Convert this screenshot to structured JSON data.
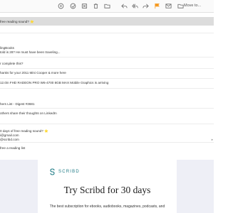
{
  "toolbar": {
    "move_label": "Move to...",
    "icons": [
      "archive-icon",
      "mark-unread-icon",
      "junk-icon",
      "trash-icon",
      "folder-icon",
      "reply-icon",
      "reply-all-icon",
      "forward-icon",
      "flag-icon",
      "email-icon"
    ],
    "flag_color": "#f59a23"
  },
  "message_list": {
    "rows": [
      {
        "text": "free reading sound? ⭐",
        "selected": true
      },
      {
        "text": "lingBooks",
        "selected": false
      },
      {
        "text": "told is 28? He must have been traveling...",
        "selected": false
      },
      {
        "text": "r complete this?",
        "selected": false
      },
      {
        "text": "hanks for your 2011 Mini Cooper & more here",
        "selected": false
      },
      {
        "text": "12.0in FHD RADEON PRO W6-4700 8GB MAX Mobile Graphics is arriving",
        "selected": false
      },
      {
        "text": "hers List - Digest #3681",
        "selected": false
      },
      {
        "text": "others share their thoughts on LinkedIn",
        "selected": false
      },
      {
        "text": "0 days of free reading sound? ⭐",
        "selected": false
      },
      {
        "text": "i@gmail.com",
        "selected": false
      },
      {
        "text": "@scribd.com",
        "selected": false
      },
      {
        "text": "free a reading list",
        "selected": false
      }
    ]
  },
  "email": {
    "brand": "SCRIBD",
    "brand_color": "#1e7b85",
    "headline": "Try Scribd for 30 days",
    "subline": "The best subscription for ebooks, audiobooks, magazines, podcasts, and"
  }
}
